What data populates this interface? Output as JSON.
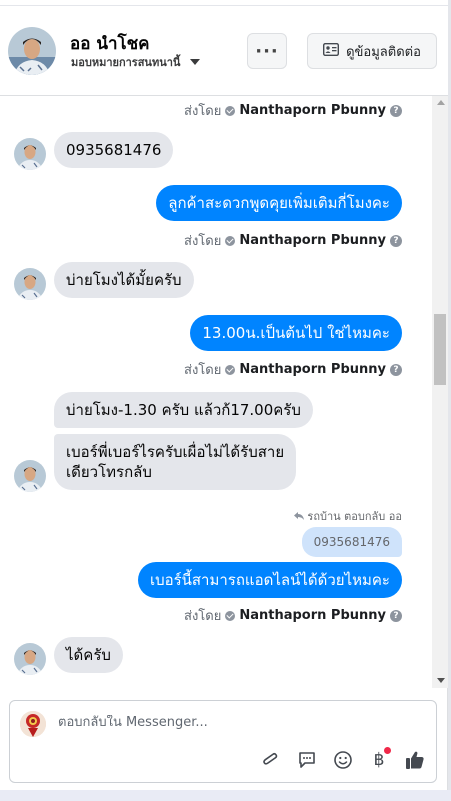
{
  "header": {
    "name": "ออ นำโชค",
    "assign_label": "มอบหมายการสนทนานี้",
    "more_label": "···",
    "contact_label": "ดูข้อมูลติดต่อ"
  },
  "sender": {
    "prefix": "ส่งโดย",
    "name": "Nanthaporn Pbunny"
  },
  "messages": {
    "m1": "0935681476",
    "m2": "ลูกค้าสะดวกพูดคุยเพิ่มเติมกี่โมงคะ",
    "m3": "บ่ายโมงได้มั้ยครับ",
    "m4": "13.00น.เป็นต้นไป ใช่ไหมคะ",
    "m5": "บ่ายโมง-1.30 ครับ  แล้วก้17.00ครับ",
    "m6a": "เบอร์พี่เบอร์ไรครับเผื่อไม่ได้รับสาย",
    "m6b": "เดียวโทรกลับ",
    "reply_meta": "รถบ้าน ตอบกลับ ออ",
    "quoted": "0935681476",
    "m7": "เบอร์นี้สามารถแอดไลน์ได้ด้วยไหมคะ",
    "m8": "ได้ครับ"
  },
  "composer": {
    "placeholder": "ตอบกลับใน Messenger..."
  },
  "colors": {
    "accent": "#0084ff",
    "incoming": "#e4e6eb"
  },
  "icons": [
    "more-icon",
    "contact-card-icon",
    "attachment-icon",
    "saved-reply-icon",
    "emoji-icon",
    "baht-payment-icon",
    "like-icon"
  ]
}
